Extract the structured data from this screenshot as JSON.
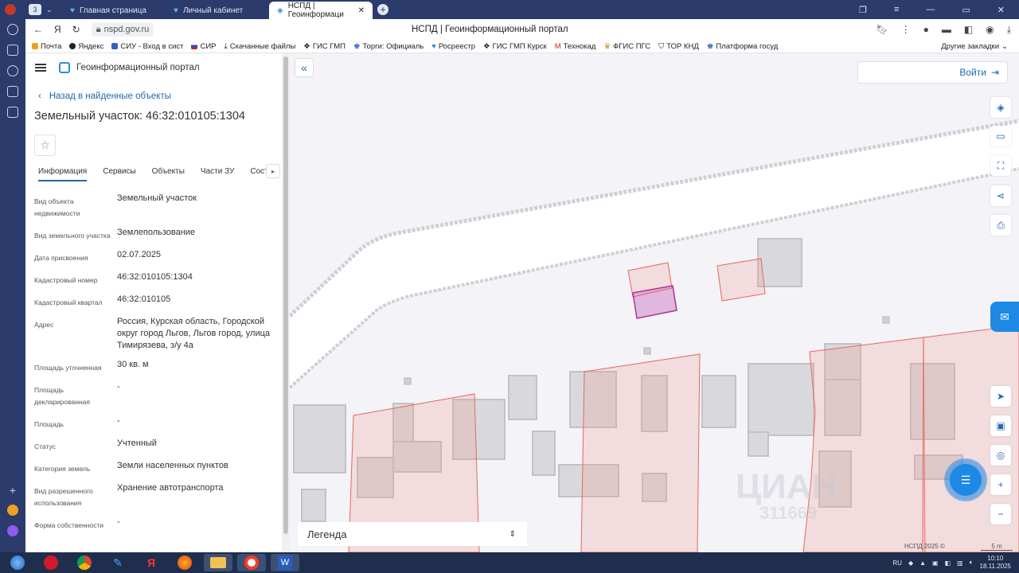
{
  "browser": {
    "tab_count_badge": "3",
    "tabs": [
      {
        "label": "Главная страница",
        "active": false
      },
      {
        "label": "Личный кабинет",
        "active": false
      },
      {
        "label": "НСПД | Геоинформаци",
        "active": true
      }
    ],
    "url": "nspd.gov.ru",
    "page_title": "НСПД | Геоинформационный портал",
    "bookmarks": [
      "Почта",
      "Яндекс",
      "СИУ - Вход в сист",
      "СИР",
      "Скачанные файлы",
      "ГИС ГМП",
      "Торги: Официаль",
      "Росреестр",
      "ГИС ГМП Курск",
      "Технокад",
      "ФГИС ПГС",
      "ТОР КНД",
      "Платформа госуд"
    ],
    "other_bookmarks": "Другие закладки"
  },
  "panel": {
    "portal_name": "Геоинформационный портал",
    "back_link": "Назад в найденные объекты",
    "title": "Земельный участок: 46:32:010105:1304",
    "tabs": [
      "Информация",
      "Сервисы",
      "Объекты",
      "Части ЗУ",
      "Соста"
    ],
    "active_tab": "Информация",
    "fields": [
      {
        "key": "Вид объекта недвижимости",
        "value": "Земельный участок"
      },
      {
        "key": "Вид земельного участка",
        "value": "Землепользование"
      },
      {
        "key": "Дата присвоения",
        "value": "02.07.2025"
      },
      {
        "key": "Кадастровый номер",
        "value": "46:32:010105:1304"
      },
      {
        "key": "Кадастровый квартал",
        "value": "46:32:010105"
      },
      {
        "key": "Адрес",
        "value": "Россия, Курская область, Городской округ город Льгов, Льгов город, улица Тимирязева, з/у 4а"
      },
      {
        "key": "Площадь уточненная",
        "value": "30 кв. м"
      },
      {
        "key": "Площадь декларированная",
        "value": "-"
      },
      {
        "key": "Площадь",
        "value": "-"
      },
      {
        "key": "Статус",
        "value": "Учтенный"
      },
      {
        "key": "Категория земель",
        "value": "Земли населенных пунктов"
      },
      {
        "key": "Вид разрешенного использования",
        "value": "Хранение автотранспорта"
      },
      {
        "key": "Форма собственности",
        "value": "-"
      }
    ]
  },
  "map": {
    "login_label": "Войти",
    "legend_label": "Легенда",
    "copyright": "НСПД 2025 ©",
    "scale_label": "5 m",
    "watermark": "ЦИАН",
    "watermark_id": "311669"
  },
  "taskbar": {
    "lang": "RU",
    "time": "10:10",
    "date": "18.11.2025"
  },
  "colors": {
    "accent": "#2268b0",
    "parcel_stroke": "#e46a5a",
    "selected_parcel": "#b0339a"
  }
}
